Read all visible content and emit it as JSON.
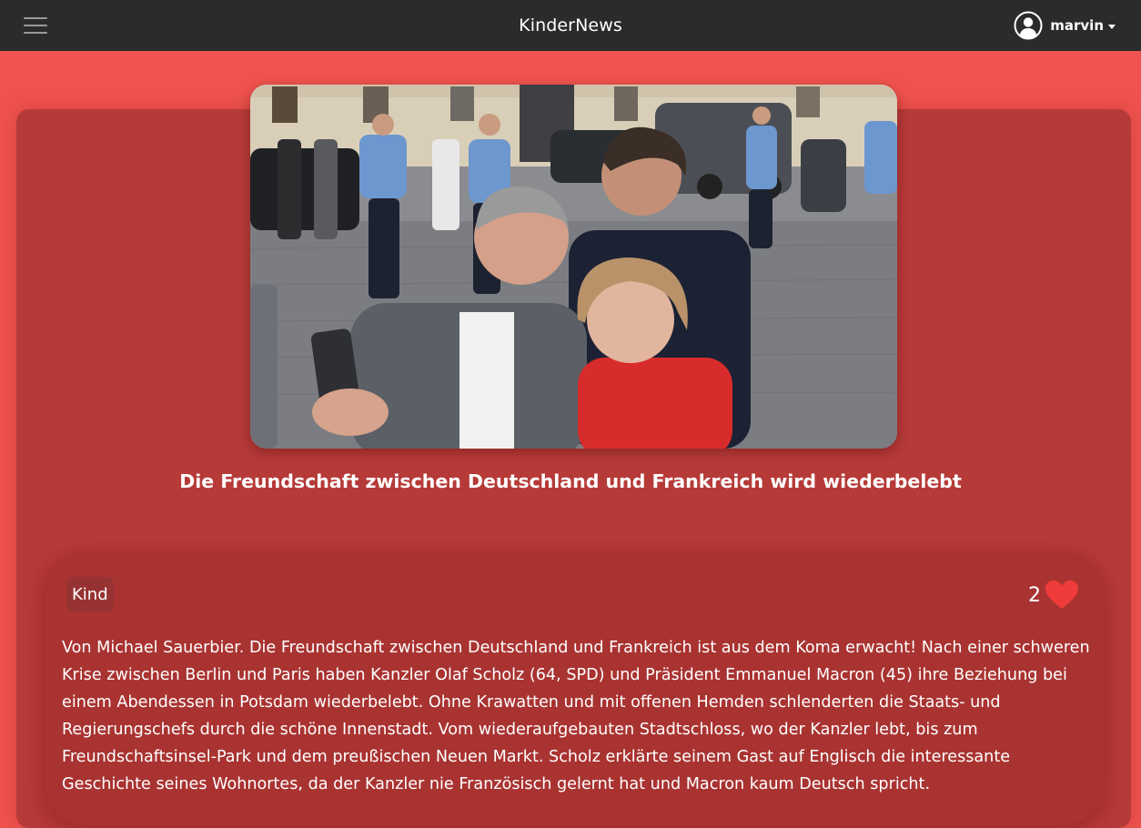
{
  "header": {
    "brand": "KinderNews",
    "username": "marvin",
    "menu_icon": "hamburger-menu-icon",
    "user_icon": "user-circle-icon"
  },
  "article": {
    "image_alt": "Selfie von Olaf Scholz mit Emmanuel Macron und einer Frau",
    "title": "Die Freundschaft zwischen Deutschland und Frankreich wird wiederbelebt",
    "tag": "Kind",
    "likes": "2",
    "like_icon": "heart-icon",
    "body": "Von Michael Sauerbier. Die Freundschaft zwischen Deutschland und Frankreich ist aus dem Koma erwacht! Nach einer schweren Krise zwischen Berlin und Paris haben Kanzler Olaf Scholz (64, SPD) und Präsident Emmanuel Macron (45) ihre Beziehung bei einem Abendessen in Potsdam wiederbelebt. Ohne Krawatten und mit offenen Hemden schlenderten die Staats- und Regierungschefs durch die schöne Innenstadt. Vom wiederaufgebauten Stadtschloss, wo der Kanzler lebt, bis zum Freundschaftsinsel-Park und dem preußischen Neuen Markt. Scholz erklärte seinem Gast auf Englisch die interessante Geschichte seines Wohnortes, da der Kanzler nie Französisch gelernt hat und Macron kaum Deutsch spricht."
  },
  "colors": {
    "page_background": "#f0534f",
    "navbar": "#2b2b2b",
    "card": "#b63a38",
    "article_card": "#a93331",
    "heart": "#ef3b3b"
  }
}
